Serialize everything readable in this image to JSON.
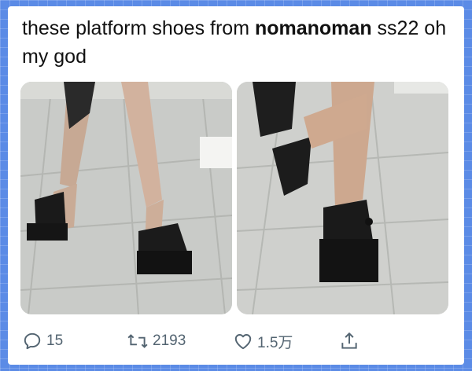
{
  "tweet": {
    "text_prefix": "these platform shoes from ",
    "text_brand": "nomanoman",
    "text_suffix": " ss22 oh my god"
  },
  "media": [
    {
      "label": "photo-left"
    },
    {
      "label": "photo-right"
    }
  ],
  "actions": {
    "reply_count": "15",
    "retweet_count": "2193",
    "like_count": "1.5万",
    "share_icon": "share-icon"
  },
  "colors": {
    "background": "#5b8be6",
    "action_gray": "#536471",
    "text": "#111111"
  }
}
